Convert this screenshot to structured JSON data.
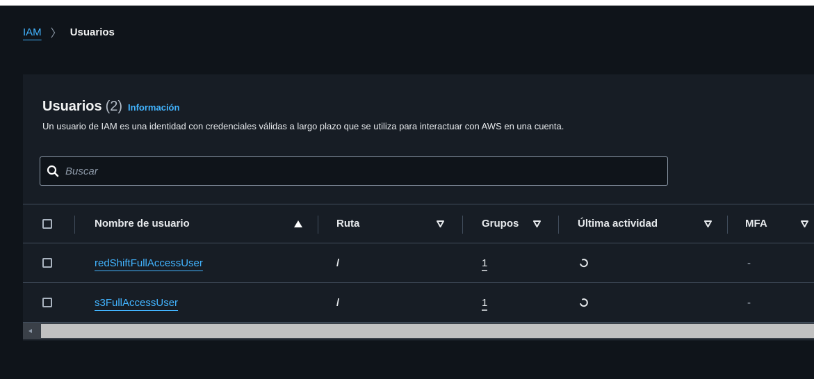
{
  "breadcrumb": {
    "root": "IAM",
    "separator": "〉",
    "current": "Usuarios"
  },
  "panel": {
    "title": "Usuarios",
    "count": "(2)",
    "info_link": "Información",
    "description": "Un usuario de IAM es una identidad con credenciales válidas a largo plazo que se utiliza para interactuar con AWS en una cuenta."
  },
  "search": {
    "placeholder": "Buscar",
    "value": "",
    "icon": "search-icon"
  },
  "table": {
    "columns": [
      {
        "label": "Nombre de usuario",
        "sort": "ascending"
      },
      {
        "label": "Ruta",
        "sort": "none"
      },
      {
        "label": "Grupos",
        "sort": "none"
      },
      {
        "label": "Última actividad",
        "sort": "none"
      },
      {
        "label": "MFA",
        "sort": "none"
      }
    ],
    "rows": [
      {
        "name": "redShiftFullAccessUser",
        "path": "/",
        "groups": "1",
        "last_activity": "loading-icon",
        "mfa": "-"
      },
      {
        "name": "s3FullAccessUser",
        "path": "/",
        "groups": "1",
        "last_activity": "loading-icon",
        "mfa": "-"
      }
    ]
  },
  "colors": {
    "page_background": "#0f141a",
    "panel_background": "#171d25",
    "link": "#42b4ff",
    "border": "#414d5c",
    "text": "#e6e9ec"
  }
}
